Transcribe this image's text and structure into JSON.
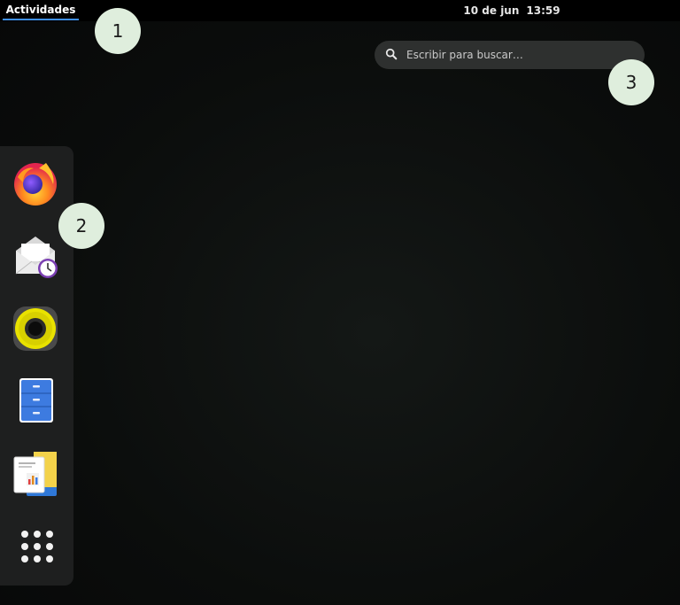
{
  "topbar": {
    "activities_label": "Actividades",
    "date": "10 de jun",
    "time": "13:59"
  },
  "search": {
    "placeholder": "Escribir para buscar…",
    "icon": "search-icon"
  },
  "dash": {
    "items": [
      {
        "name": "firefox",
        "icon": "firefox-icon"
      },
      {
        "name": "evolution-mail",
        "icon": "mail-clock-icon"
      },
      {
        "name": "rhythmbox",
        "icon": "speaker-icon"
      },
      {
        "name": "files",
        "icon": "file-cabinet-icon"
      },
      {
        "name": "office-documents",
        "icon": "documents-icon"
      },
      {
        "name": "show-applications",
        "icon": "app-grid-icon"
      }
    ]
  },
  "callouts": [
    "1",
    "2",
    "3"
  ],
  "colors": {
    "accent": "#3f8fe6",
    "callout_bg": "#dfeedd",
    "dash_bg": "#1e1f1f"
  }
}
